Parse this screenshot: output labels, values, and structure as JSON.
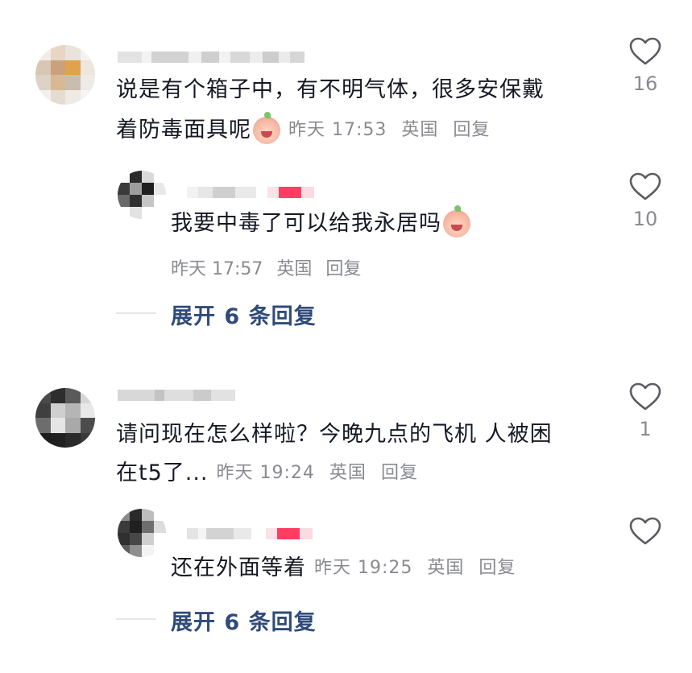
{
  "comments": [
    {
      "text_line1": "说是有个箱子中，有不明气体，很多安保戴",
      "text_line2": "着防毒面具呢",
      "emoji": "smiling-peach-emoji",
      "time": "昨天 17:53",
      "location": "英国",
      "reply_label": "回复",
      "likes": "16",
      "reply": {
        "text": "我要中毒了可以给我永居吗",
        "emoji": "crying-peach-emoji",
        "time": "昨天 17:57",
        "location": "英国",
        "reply_label": "回复",
        "likes": "10"
      },
      "expand_label": "展开 6 条回复"
    },
    {
      "text_line1": "请问现在怎么样啦？今晚九点的飞机 人被困",
      "text_line2": "在t5了...",
      "time": "昨天 19:24",
      "location": "英国",
      "reply_label": "回复",
      "likes": "1",
      "reply": {
        "text": "还在外面等着",
        "time": "昨天 19:25",
        "location": "英国",
        "reply_label": "回复",
        "likes": ""
      },
      "expand_label": "展开 6 条回复"
    }
  ],
  "icons": {
    "like": "heart-outline-icon"
  },
  "colors": {
    "text": "#161823",
    "meta": "#8a8b91",
    "expand": "#2f4b7a",
    "author_tag": "#ff2b55"
  }
}
